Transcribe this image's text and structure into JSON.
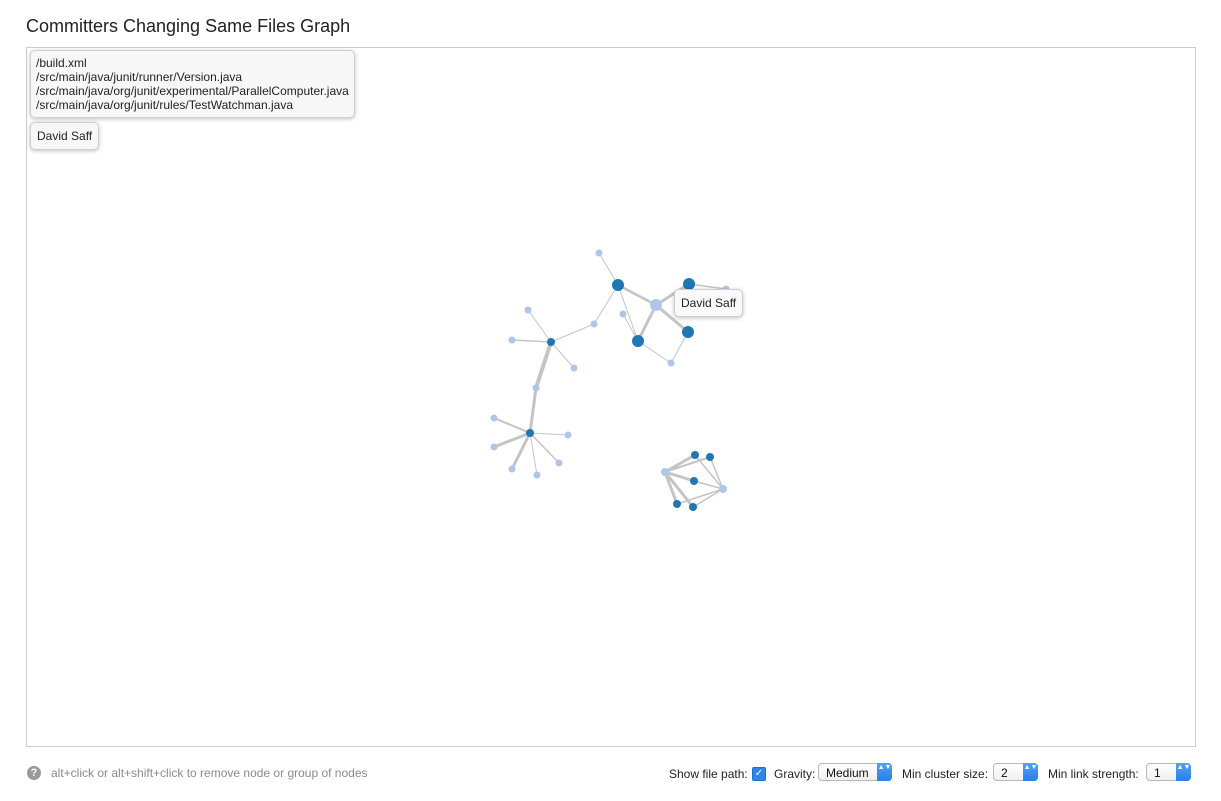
{
  "page": {
    "title": "Committers Changing Same Files Graph"
  },
  "tooltips": {
    "files": [
      "/build.xml",
      "/src/main/java/junit/runner/Version.java",
      "/src/main/java/org/junit/experimental/ParallelComputer.java",
      "/src/main/java/org/junit/rules/TestWatchman.java"
    ],
    "pinned_author": "David Saff",
    "hover_author": "David Saff"
  },
  "graph": {
    "colors": {
      "committer": "#1f77b4",
      "file": "#aec7e8",
      "link": "#c4c4c4"
    }
  },
  "footer": {
    "help_icon": "question-circle-icon",
    "help_glyph": "?",
    "hint": "alt+click or alt+shift+click to remove node or group of nodes",
    "show_file_path_label": "Show file path:",
    "show_file_path_checked": true,
    "checkmark_glyph": "✓",
    "gravity_label": "Gravity:",
    "gravity_value": "Medium",
    "min_cluster_label": "Min cluster size:",
    "min_cluster_value": "2",
    "min_link_label": "Min link strength:",
    "min_link_value": "1",
    "select_arrow_glyph": "▲▼"
  }
}
